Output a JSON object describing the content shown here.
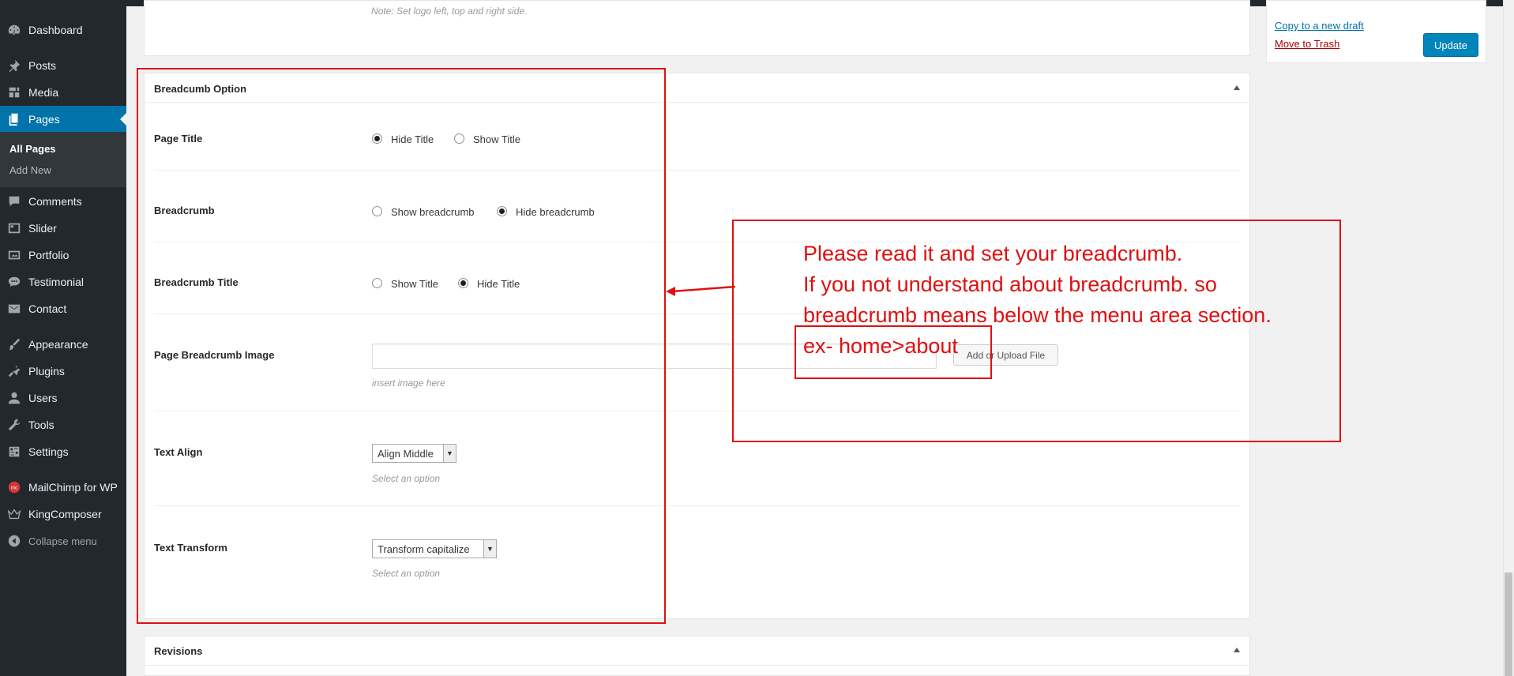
{
  "sidebar": {
    "items": [
      {
        "label": "Dashboard",
        "icon": "dashboard-icon"
      },
      {
        "label": "Posts",
        "icon": "pin-icon"
      },
      {
        "label": "Media",
        "icon": "media-icon"
      },
      {
        "label": "Pages",
        "icon": "pages-icon"
      },
      {
        "label": "Comments",
        "icon": "comment-icon"
      },
      {
        "label": "Slider",
        "icon": "slider-icon"
      },
      {
        "label": "Portfolio",
        "icon": "portfolio-icon"
      },
      {
        "label": "Testimonial",
        "icon": "testimonial-icon"
      },
      {
        "label": "Contact",
        "icon": "mail-icon"
      },
      {
        "label": "Appearance",
        "icon": "brush-icon"
      },
      {
        "label": "Plugins",
        "icon": "plugin-icon"
      },
      {
        "label": "Users",
        "icon": "user-icon"
      },
      {
        "label": "Tools",
        "icon": "wrench-icon"
      },
      {
        "label": "Settings",
        "icon": "settings-icon"
      },
      {
        "label": "MailChimp for WP",
        "icon": "mailchimp-icon"
      },
      {
        "label": "KingComposer",
        "icon": "crown-icon"
      }
    ],
    "submenu": [
      "All Pages",
      "Add New"
    ],
    "collapse": "Collapse menu"
  },
  "top_box": {
    "note": "Note: Set logo left, top and right side."
  },
  "breadcrumb_box": {
    "title": "Breadcumb Option",
    "page_title": {
      "label": "Page Title",
      "options": [
        "Hide Title",
        "Show Title"
      ],
      "selected": "Hide Title"
    },
    "breadcrumb": {
      "label": "Breadcrumb",
      "options": [
        "Show breadcrumb",
        "Hide breadcrumb"
      ],
      "selected": "Hide breadcrumb"
    },
    "breadcrumb_title": {
      "label": "Breadcrumb Title",
      "options": [
        "Show Title",
        "Hide Title"
      ],
      "selected": "Hide Title"
    },
    "image": {
      "label": "Page Breadcrumb Image",
      "value": "",
      "button": "Add or Upload File",
      "desc": "insert image here"
    },
    "text_align": {
      "label": "Text Align",
      "value": "Align Middle",
      "desc": "Select an option"
    },
    "text_transform": {
      "label": "Text Transform",
      "value": "Transform capitalize",
      "desc": "Select an option"
    }
  },
  "revisions_box": {
    "title": "Revisions"
  },
  "publish": {
    "copy_link": "Copy to a new draft",
    "trash_link": "Move to Trash",
    "update_button": "Update"
  },
  "annotation": {
    "lines": [
      "Please read it and set your breadcrumb.",
      "If you not understand about breadcrumb. so",
      "breadcrumb means below the menu area section.",
      "ex- home>about"
    ],
    "color": "#e01010"
  },
  "colors": {
    "sidebar_bg": "#23282d",
    "accent": "#0073aa",
    "annotation": "#e01010"
  }
}
